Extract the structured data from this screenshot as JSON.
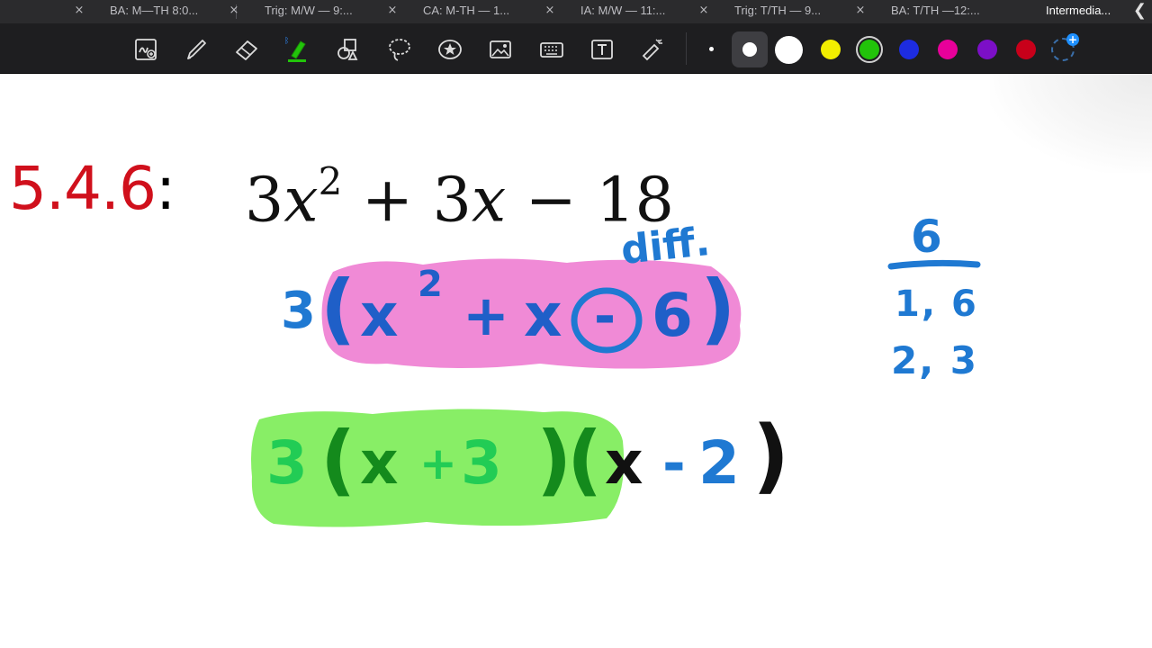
{
  "tabs": [
    {
      "label": "BA: M—TH 8:0..."
    },
    {
      "label": "Trig: M/W — 9:..."
    },
    {
      "label": "CA: M-TH — 1..."
    },
    {
      "label": "IA: M/W — 11:..."
    },
    {
      "label": "Trig: T/TH — 9..."
    },
    {
      "label": "BA: T/TH —12:..."
    },
    {
      "label": "Intermedia..."
    }
  ],
  "tab_close_glyph": "×",
  "tab_collapse_glyph": "❮",
  "toolbar": {
    "tools": [
      {
        "icon": "handwriting-to-text-icon"
      },
      {
        "icon": "pen-icon"
      },
      {
        "icon": "eraser-icon"
      },
      {
        "icon": "highlighter-icon",
        "active": true,
        "bluetooth": true
      },
      {
        "icon": "shapes-icon"
      },
      {
        "icon": "lasso-icon"
      },
      {
        "icon": "sticker-icon"
      },
      {
        "icon": "image-icon"
      },
      {
        "icon": "keyboard-icon"
      },
      {
        "icon": "text-box-icon"
      },
      {
        "icon": "laser-pointer-icon"
      }
    ],
    "colors": [
      "#ffffff",
      "#ffffff",
      "#ffffff",
      "#f2ee00",
      "#22c40a",
      "#1d2ce0",
      "#e8009a",
      "#7c0fc7",
      "#c8001a"
    ],
    "selected_size": 2,
    "selected_color": "#22c40a"
  },
  "canvas": {
    "problem_number": "5.4.6",
    "problem_colon": ":",
    "equation": {
      "term1_coef": "3",
      "term1_var": "x",
      "term1_exp": "2",
      "op1": " + ",
      "term2_coef": "3",
      "term2_var": "x",
      "op2": " − ",
      "constant": "18"
    },
    "handwriting": {
      "gcf_step": {
        "coef": "3",
        "open": "(",
        "x": "x",
        "exp": "2",
        "plus": "+",
        "x2": "x",
        "circled_sign": "-",
        "const": "6",
        "close": ")"
      },
      "annotation": "diff.",
      "factored": {
        "coef": "3",
        "open1": "(",
        "x1": "x",
        "plus": "+",
        "n1": "3",
        "close1": ")",
        "open2": "(",
        "x2": "x",
        "minus": "-",
        "n2": "2",
        "close2": ")"
      },
      "factor_work": {
        "target": "6",
        "pair1": "1, 6",
        "pair2": "2, 3"
      }
    },
    "ink_colors": {
      "blue": "#1f79d2",
      "green_dark": "#148a1c",
      "green_light": "#22cc55",
      "black": "#111111",
      "pink_highlight": "#f08ad6",
      "green_highlight": "#88ee66"
    }
  }
}
